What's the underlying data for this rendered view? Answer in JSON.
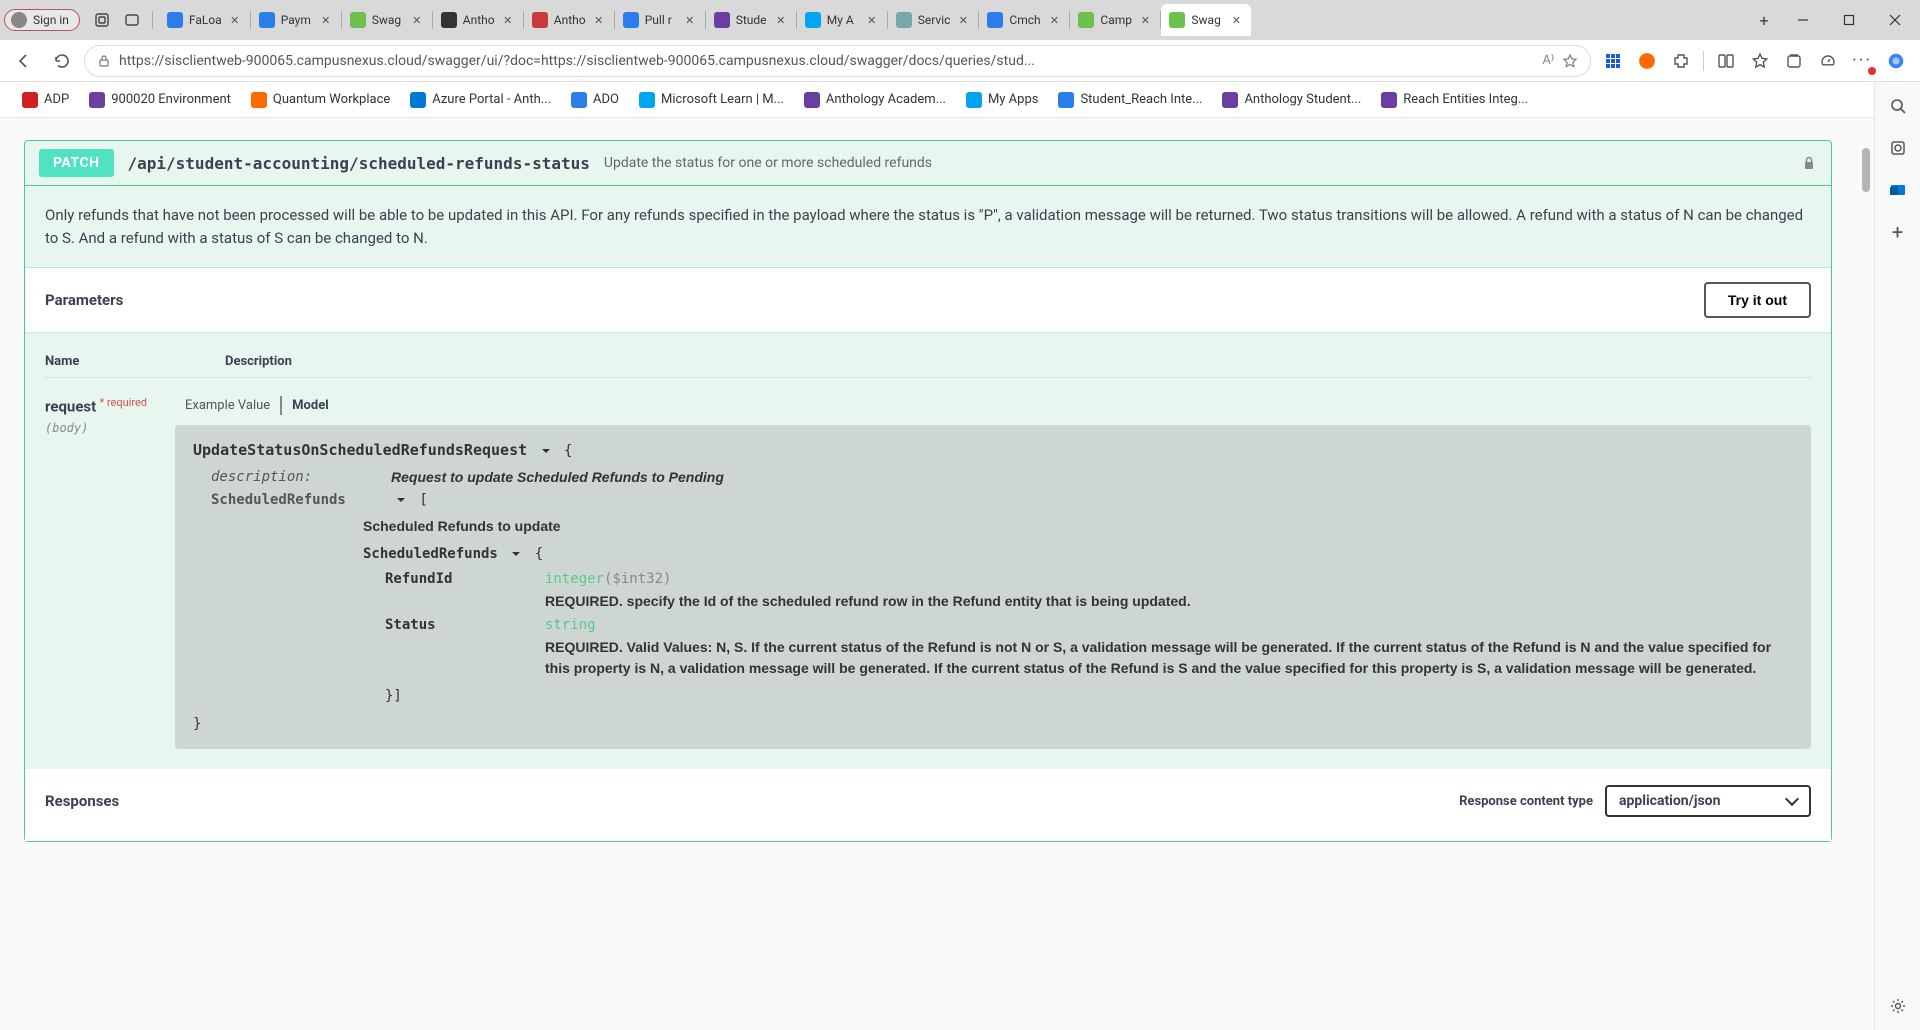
{
  "browser": {
    "signin": "Sign in",
    "url": "https://sisclientweb-900065.campusnexus.cloud/swagger/ui/?doc=https://sisclientweb-900065.campusnexus.cloud/swagger/docs/queries/stud...",
    "tabs": [
      {
        "label": "FaLoa",
        "color": "#2b7de9"
      },
      {
        "label": "Paym",
        "color": "#2b7de9"
      },
      {
        "label": "Swag",
        "color": "#6cc24a"
      },
      {
        "label": "Antho",
        "color": "#333"
      },
      {
        "label": "Antho",
        "color": "#cc3b3b"
      },
      {
        "label": "Pull r",
        "color": "#2b7de9"
      },
      {
        "label": "Stude",
        "color": "#6b3fa0"
      },
      {
        "label": "My A",
        "color": "#00a4ef"
      },
      {
        "label": "Servic",
        "color": "#7aa"
      },
      {
        "label": "Cmch",
        "color": "#2b7de9"
      },
      {
        "label": "Camp",
        "color": "#6cc24a"
      },
      {
        "label": "Swag",
        "color": "#6cc24a",
        "active": true
      }
    ],
    "bookmarks": [
      {
        "label": "ADP",
        "color": "#d21f1f"
      },
      {
        "label": "900020 Environment",
        "color": "#6b3fa0"
      },
      {
        "label": "Quantum Workplace",
        "color": "#ff6a00"
      },
      {
        "label": "Azure Portal - Anth...",
        "color": "#0078d4"
      },
      {
        "label": "ADO",
        "color": "#2b7de9"
      },
      {
        "label": "Microsoft Learn | M...",
        "color": "#00a4ef"
      },
      {
        "label": "Anthology Academ...",
        "color": "#6b3fa0"
      },
      {
        "label": "My Apps",
        "color": "#00a4ef"
      },
      {
        "label": "Student_Reach Inte...",
        "color": "#2b7de9"
      },
      {
        "label": "Anthology Student...",
        "color": "#6b3fa0"
      },
      {
        "label": "Reach Entities Integ...",
        "color": "#6b3fa0"
      }
    ]
  },
  "op": {
    "method": "PATCH",
    "path": "/api/student-accounting/scheduled-refunds-status",
    "summary": "Update the status for one or more scheduled refunds",
    "description": "Only refunds that have not been processed will be able to be updated in this API. For any refunds specified in the payload where the status is \"P\", a validation message will be returned. Two status transitions will be allowed. A refund with a status of N can be changed to S. And a refund with a status of S can be changed to N.",
    "parameters_title": "Parameters",
    "try_it": "Try it out",
    "col_name": "Name",
    "col_desc": "Description",
    "param_name": "request",
    "required_label": "* required",
    "param_in": "(body)",
    "example_value": "Example Value",
    "model_label": "Model"
  },
  "model": {
    "root_name": "UpdateStatusOnScheduledRefundsRequest",
    "desc_key": "description:",
    "desc_val": "Request to update Scheduled Refunds to Pending",
    "list_key": "ScheduledRefunds",
    "list_desc": "Scheduled Refunds to update",
    "item_name": "ScheduledRefunds",
    "p1_key": "RefundId",
    "p1_type": "integer",
    "p1_fmt": "($int32)",
    "p1_desc": "REQUIRED. specify the Id of the scheduled refund row in the Refund entity that is being updated.",
    "p2_key": "Status",
    "p2_type": "string",
    "p2_desc": "REQUIRED. Valid Values: N, S. If the current status of the Refund is not N or S, a validation message will be generated. If the current status of the Refund is N and the value specified for this property is N, a validation message will be generated. If the current status of the Refund is S and the value specified for this property is S, a validation message will be generated.",
    "close": "}]",
    "root_close": "}"
  },
  "responses": {
    "title": "Responses",
    "content_type_label": "Response content type",
    "content_type_value": "application/json"
  }
}
